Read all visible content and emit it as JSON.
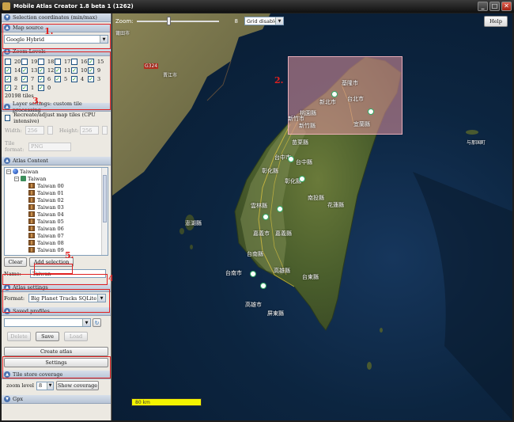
{
  "window": {
    "title": "Mobile Atlas Creator 1.8 beta 1 (1262)",
    "min": "_",
    "max": "□",
    "close": "✕"
  },
  "panel": {
    "selection_coords_header": "Selection coordinates (min/max)",
    "map_source": {
      "header": "Map source",
      "value": "Google Hybrid"
    },
    "zoom_levels": {
      "header": "Zoom Levels",
      "levels": [
        "20",
        "19",
        "18",
        "17",
        "16",
        "15",
        "14",
        "13",
        "12",
        "11",
        "10",
        "9",
        "8",
        "7",
        "6",
        "5",
        "4",
        "3",
        "2",
        "1",
        "0"
      ],
      "checked": [
        "15",
        "14",
        "13",
        "12",
        "11",
        "10",
        "9",
        "8",
        "7",
        "6",
        "5",
        "4",
        "3",
        "2",
        "1",
        "0"
      ],
      "tiles_label": "20198 tiles"
    },
    "layer_settings": {
      "header": "Layer settings: custom tile processing",
      "recreate_label": "Recreate/adjust map tiles (CPU intensive)",
      "width_label": "Width:",
      "width_value": "256",
      "height_label": "Height:",
      "height_value": "256",
      "format_label": "Tile format:",
      "format_value": "PNG"
    },
    "atlas_content": {
      "header": "Atlas Content",
      "root": "Taiwan",
      "layer": "Taiwan",
      "maps": [
        "Taiwan 00",
        "Taiwan 01",
        "Taiwan 02",
        "Taiwan 03",
        "Taiwan 04",
        "Taiwan 05",
        "Taiwan 06",
        "Taiwan 07",
        "Taiwan 08",
        "Taiwan 09"
      ],
      "clear_label": "Clear",
      "add_selection_label": "Add selection",
      "name_label": "Name:",
      "name_value": "Taiwan"
    },
    "atlas_settings": {
      "header": "Atlas settings",
      "format_label": "Format:",
      "format_value": "Big Planet Tracks SQLite"
    },
    "saved_profiles": {
      "header": "Saved profiles",
      "value": "",
      "delete_label": "Delete",
      "save_label": "Save",
      "load_label": "Load"
    },
    "create_atlas_label": "Create atlas",
    "settings_label": "Settings",
    "tile_store": {
      "header": "Tile store coverage",
      "zoom_label": "zoom level",
      "zoom_value": "8",
      "show_label": "Show coverage"
    },
    "gpx_header": "Gpx"
  },
  "annotations": [
    "1.",
    "2.",
    "3.",
    "4.",
    "5.",
    "6.",
    "7."
  ],
  "map": {
    "zoom_label": "Zoom:",
    "zoom_value": "8",
    "grid_value": "Grid disabled",
    "help_label": "Help",
    "scale_label": "80 km",
    "labels": {
      "taipei_city": "台北市",
      "keelung": "基隆市",
      "xinbei": "新北市",
      "taoyuan": "桃園縣",
      "hsinchu_city": "新竹市",
      "hsinchu_county": "新竹縣",
      "yilan": "宜蘭縣",
      "miaoli": "苗栗縣",
      "taichung_city": "台中市",
      "taichung_county": "台中縣",
      "changhua": "彰化縣",
      "nantou": "南投縣",
      "hualien": "花蓮縣",
      "yunlin": "雲林縣",
      "chiayi_county": "嘉義縣",
      "chiayi_city": "嘉義市",
      "penghu": "澎湖縣",
      "tainan_county": "台南縣",
      "tainan_city": "台南市",
      "kaohsiung_county": "高雄縣",
      "kaohsiung_city": "高雄市",
      "taitung": "台東縣",
      "pingtung": "屏東縣",
      "yonaguni": "与那国町",
      "putian": "莆田市",
      "jinjiang": "晋江市",
      "road_label": "G324"
    }
  }
}
